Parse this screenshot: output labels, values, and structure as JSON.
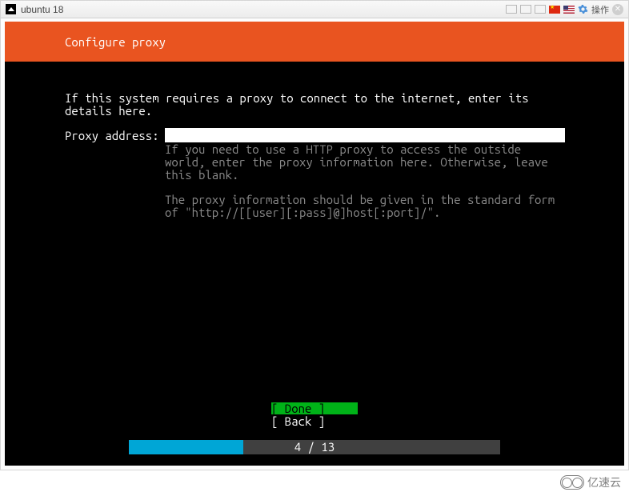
{
  "window": {
    "title": "ubuntu 18",
    "action_label": "操作"
  },
  "header": {
    "title": "Configure proxy"
  },
  "body": {
    "instruction": "If this system requires a proxy to connect to the internet, enter its details here.",
    "proxy_label": "Proxy address:",
    "proxy_value": "",
    "help_text": "If you need to use a HTTP proxy to access the outside world, enter the proxy information here. Otherwise, leave this blank.\n\nThe proxy information should be given in the standard form of \"http://[[user][:pass]@]host[:port]/\"."
  },
  "buttons": {
    "done": "[ Done       ]",
    "back": "[ Back       ]"
  },
  "progress": {
    "current": 4,
    "total": 13,
    "text": "4 / 13"
  },
  "watermark": {
    "text": "亿速云"
  }
}
